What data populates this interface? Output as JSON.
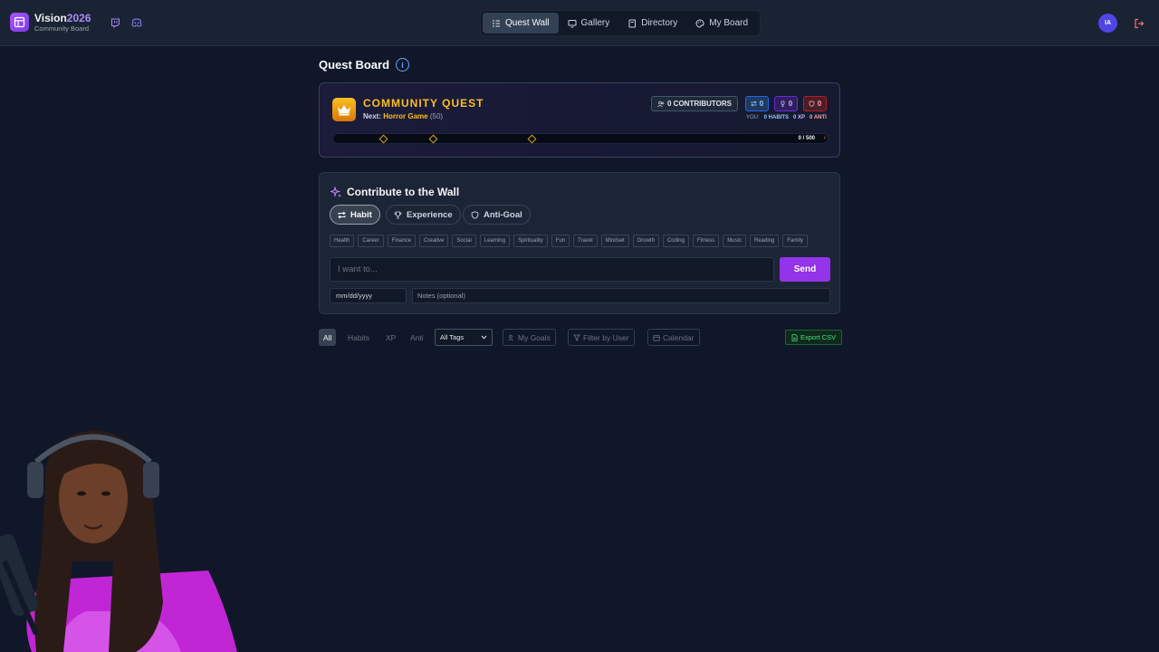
{
  "brand": {
    "title_main": "Vision",
    "title_accent": "2026",
    "subtitle": "Community Board"
  },
  "nav": [
    {
      "label": "Quest Wall",
      "icon": "list-icon",
      "active": true
    },
    {
      "label": "Gallery",
      "icon": "monitor-icon",
      "active": false
    },
    {
      "label": "Directory",
      "icon": "book-icon",
      "active": false
    },
    {
      "label": "My Board",
      "icon": "palette-icon",
      "active": false
    }
  ],
  "user": {
    "initials": "IA"
  },
  "page": {
    "title": "Quest Board"
  },
  "quest": {
    "title": "COMMUNITY QUEST",
    "next_label": "Next:",
    "next_game": "Horror Game",
    "next_cost": "(50)",
    "contributors": "0 CONTRIBUTORS",
    "stats": {
      "habits": "0",
      "xp": "0",
      "anti": "0"
    },
    "you": {
      "label": "YOU:",
      "habits": "0 HABITS",
      "xp": "0 XP",
      "anti": "0 ANTI"
    },
    "progress": {
      "current": 0,
      "total": 500,
      "text": "0 / 500"
    }
  },
  "contribute": {
    "title": "Contribute to the Wall",
    "types": [
      "Habit",
      "Experience",
      "Anti-Goal"
    ],
    "tags": [
      "Health",
      "Career",
      "Finance",
      "Creative",
      "Social",
      "Learning",
      "Spirituality",
      "Fun",
      "Travel",
      "Mindset",
      "Growth",
      "Coding",
      "Fitness",
      "Music",
      "Reading",
      "Family"
    ],
    "input_placeholder": "I want to...",
    "send_label": "Send",
    "date_placeholder": "mm/dd/yyyy",
    "notes_placeholder": "Notes (optional)"
  },
  "filters": {
    "all": "All",
    "habits": "Habits",
    "xp": "XP",
    "anti": "Anti",
    "tags_select": "All Tags",
    "my_goals": "My Goals",
    "filter_user": "Filter by User",
    "calendar": "Calendar",
    "export": "Export CSV"
  },
  "colors": {
    "accent": "#9333ea",
    "gold": "#fbbf24",
    "background": "#0f1729"
  }
}
